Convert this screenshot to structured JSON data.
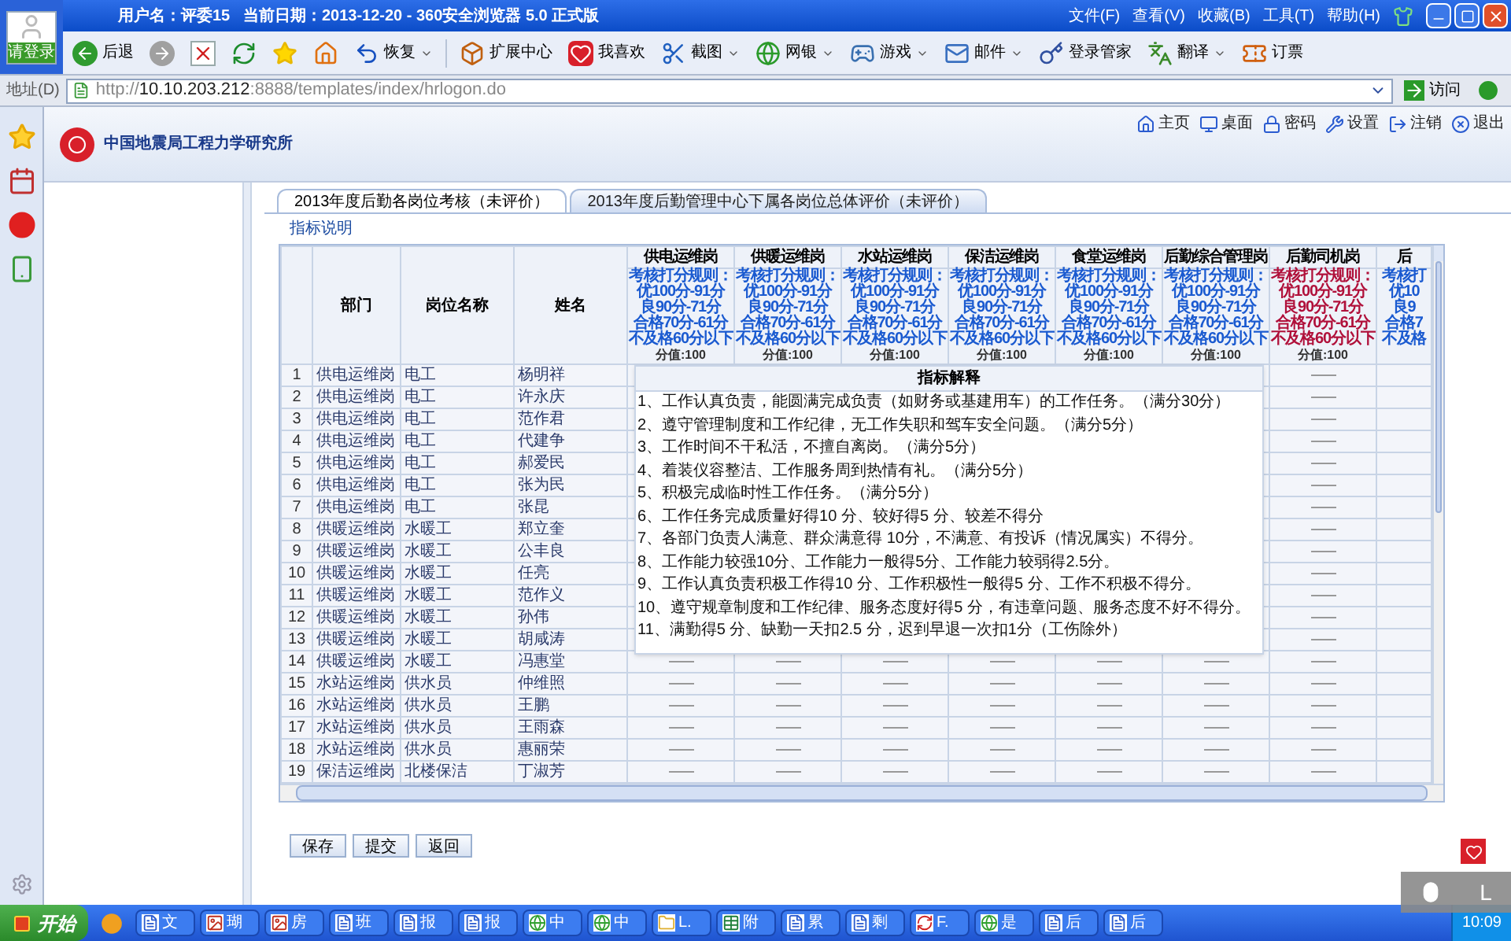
{
  "browser": {
    "title": "用户名：评委15   当前日期：2013-12-20 - 360安全浏览器 5.0 正式版",
    "menu": [
      "文件(F)",
      "查看(V)",
      "收藏(B)",
      "工具(T)",
      "帮助(H)"
    ],
    "login_label": "请登录",
    "toolbar": [
      {
        "kind": "back",
        "label": "后退",
        "dropdown": false
      },
      {
        "kind": "forward",
        "dropdown": false
      },
      {
        "kind": "stop",
        "dropdown": false
      },
      {
        "kind": "refresh",
        "dropdown": false
      },
      {
        "kind": "favorite",
        "dropdown": false
      },
      {
        "kind": "home",
        "dropdown": false
      },
      {
        "kind": "restore",
        "label": "恢复",
        "dropdown": true
      },
      {
        "kind": "extensions",
        "label": "扩展中心",
        "dropdown": false
      },
      {
        "kind": "like",
        "label": "我喜欢",
        "dropdown": false
      },
      {
        "kind": "screenshot",
        "label": "截图",
        "dropdown": true
      },
      {
        "kind": "bank",
        "label": "网银",
        "dropdown": true
      },
      {
        "kind": "games",
        "label": "游戏",
        "dropdown": true
      },
      {
        "kind": "mail",
        "label": "邮件",
        "dropdown": true
      },
      {
        "kind": "password",
        "label": "登录管家",
        "dropdown": false
      },
      {
        "kind": "translate",
        "label": "翻译",
        "dropdown": true
      },
      {
        "kind": "tickets",
        "label": "订票",
        "dropdown": false
      }
    ],
    "address_label": "地址(D)",
    "url_prefix": "http://",
    "url_host": "10.10.203.212",
    "url_path": ":8888/templates/index/hrlogon.do",
    "go_label": "访问"
  },
  "site": {
    "org_name": "中国地震局工程力学研究所",
    "links": [
      {
        "kind": "home",
        "label": "主页"
      },
      {
        "kind": "desktop",
        "label": "桌面"
      },
      {
        "kind": "password",
        "label": "密码"
      },
      {
        "kind": "settings",
        "label": "设置"
      },
      {
        "kind": "logout",
        "label": "注销"
      },
      {
        "kind": "exit",
        "label": "退出"
      }
    ]
  },
  "tabs": [
    {
      "label": "2013年度后勤各岗位考核（未评价）",
      "selected": true
    },
    {
      "label": "2013年度后勤管理中心下属各岗位总体评价（未评价）",
      "selected": false
    }
  ],
  "indicator_link": "指标说明",
  "table": {
    "columns": [
      "部门",
      "岗位名称",
      "姓名"
    ],
    "score_columns": [
      {
        "name": "供电运维岗",
        "rules": [
          "考核打分规则：",
          "优100分-91分",
          "良90分-71分",
          "合格70分-61分",
          "不及格60分以下"
        ],
        "score_value": "分值:100",
        "highlight": false
      },
      {
        "name": "供暖运维岗",
        "rules": [
          "考核打分规则：",
          "优100分-91分",
          "良90分-71分",
          "合格70分-61分",
          "不及格60分以下"
        ],
        "score_value": "分值:100",
        "highlight": false
      },
      {
        "name": "水站运维岗",
        "rules": [
          "考核打分规则：",
          "优100分-91分",
          "良90分-71分",
          "合格70分-61分",
          "不及格60分以下"
        ],
        "score_value": "分值:100",
        "highlight": false
      },
      {
        "name": "保洁运维岗",
        "rules": [
          "考核打分规则：",
          "优100分-91分",
          "良90分-71分",
          "合格70分-61分",
          "不及格60分以下"
        ],
        "score_value": "分值:100",
        "highlight": false
      },
      {
        "name": "食堂运维岗",
        "rules": [
          "考核打分规则：",
          "优100分-91分",
          "良90分-71分",
          "合格70分-61分",
          "不及格60分以下"
        ],
        "score_value": "分值:100",
        "highlight": false
      },
      {
        "name": "后勤综合管理岗",
        "rules": [
          "考核打分规则：",
          "优100分-91分",
          "良90分-71分",
          "合格70分-61分",
          "不及格60分以下"
        ],
        "score_value": "分值:100",
        "highlight": false
      },
      {
        "name": "后勤司机岗",
        "rules": [
          "考核打分规则：",
          "优100分-91分",
          "良90分-71分",
          "合格70分-61分",
          "不及格60分以下"
        ],
        "score_value": "分值:100",
        "highlight": true
      },
      {
        "name": "后",
        "rules": [
          "考核打",
          "优10",
          "良9",
          "合格7",
          "不及格"
        ],
        "highlight": false
      }
    ],
    "rows": [
      {
        "index": "1",
        "dept": "供电运维岗",
        "post": "电工",
        "name": "杨明祥"
      },
      {
        "index": "2",
        "dept": "供电运维岗",
        "post": "电工",
        "name": "许永庆"
      },
      {
        "index": "3",
        "dept": "供电运维岗",
        "post": "电工",
        "name": "范作君"
      },
      {
        "index": "4",
        "dept": "供电运维岗",
        "post": "电工",
        "name": "代建争"
      },
      {
        "index": "5",
        "dept": "供电运维岗",
        "post": "电工",
        "name": "郝爱民"
      },
      {
        "index": "6",
        "dept": "供电运维岗",
        "post": "电工",
        "name": "张为民"
      },
      {
        "index": "7",
        "dept": "供电运维岗",
        "post": "电工",
        "name": "张昆"
      },
      {
        "index": "8",
        "dept": "供暖运维岗",
        "post": "水暖工",
        "name": "郑立奎"
      },
      {
        "index": "9",
        "dept": "供暖运维岗",
        "post": "水暖工",
        "name": "公丰良"
      },
      {
        "index": "10",
        "dept": "供暖运维岗",
        "post": "水暖工",
        "name": "任亮"
      },
      {
        "index": "11",
        "dept": "供暖运维岗",
        "post": "水暖工",
        "name": "范作义"
      },
      {
        "index": "12",
        "dept": "供暖运维岗",
        "post": "水暖工",
        "name": "孙伟"
      },
      {
        "index": "13",
        "dept": "供暖运维岗",
        "post": "水暖工",
        "name": "胡咸涛"
      },
      {
        "index": "14",
        "dept": "供暖运维岗",
        "post": "水暖工",
        "name": "冯惠堂"
      },
      {
        "index": "15",
        "dept": "水站运维岗",
        "post": "供水员",
        "name": "仲维照"
      },
      {
        "index": "16",
        "dept": "水站运维岗",
        "post": "供水员",
        "name": "王鹏"
      },
      {
        "index": "17",
        "dept": "水站运维岗",
        "post": "供水员",
        "name": "王雨森"
      },
      {
        "index": "18",
        "dept": "水站运维岗",
        "post": "供水员",
        "name": "惠丽荣"
      },
      {
        "index": "19",
        "dept": "保洁运维岗",
        "post": "北楼保洁",
        "name": "丁淑芳"
      }
    ]
  },
  "popup": {
    "title": "指标解释",
    "lines": [
      "1、工作认真负责，能圆满完成负责（如财务或基建用车）的工作任务。（满分30分）",
      "2、遵守管理制度和工作纪律，无工作失职和驾车安全问题。（满分5分）",
      "3、工作时间不干私活，不擅自离岗。（满分5分）",
      "4、着装仪容整洁、工作服务周到热情有礼。（满分5分）",
      "5、积极完成临时性工作任务。（满分5分）",
      "6、工作任务完成质量好得10 分、较好得5 分、较差不得分",
      "7、各部门负责人满意、群众满意得 10分，不满意、有投诉（情况属实）不得分。",
      "8、工作能力较强10分、工作能力一般得5分、工作能力较弱得2.5分。",
      "9、工作认真负责积极工作得10 分、工作积极性一般得5 分、工作不积极不得分。",
      "10、遵守规章制度和工作纪律、服务态度好得5 分，有违章问题、服务态度不好不得分。",
      "11、满勤得5 分、缺勤一天扣2.5 分，迟到早退一次扣1分（工伤除外）"
    ]
  },
  "buttons": [
    "保存",
    "提交",
    "返回"
  ],
  "taskbar": {
    "start": "开始",
    "tasks": [
      {
        "kind": "doc",
        "label": "文"
      },
      {
        "kind": "image",
        "label": "瑚"
      },
      {
        "kind": "image",
        "label": "房"
      },
      {
        "kind": "doc",
        "label": "班"
      },
      {
        "kind": "doc",
        "label": "报"
      },
      {
        "kind": "doc",
        "label": "报"
      },
      {
        "kind": "browser",
        "label": "中"
      },
      {
        "kind": "browser",
        "label": "中"
      },
      {
        "kind": "folder",
        "label": "L."
      },
      {
        "kind": "sheet",
        "label": "附"
      },
      {
        "kind": "doc",
        "label": "累"
      },
      {
        "kind": "doc",
        "label": "剩"
      },
      {
        "kind": "swirl",
        "label": "F."
      },
      {
        "kind": "browser",
        "label": "是"
      },
      {
        "kind": "doc",
        "label": "后"
      },
      {
        "kind": "doc",
        "label": "后"
      }
    ],
    "clock": "10:09"
  },
  "overlay": {
    "label": "L"
  }
}
